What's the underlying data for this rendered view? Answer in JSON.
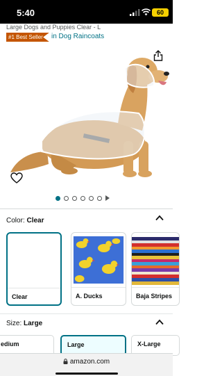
{
  "status": {
    "time": "5:40",
    "battery": "60"
  },
  "product": {
    "title": "Large Dogs and Puppies Clear - L",
    "badge": "#1 Best Seller",
    "category": "in Dog Raincoats"
  },
  "gallery": {
    "image_count": 6,
    "current_index": 1
  },
  "color": {
    "label": "Color:",
    "selected": "Clear",
    "options": [
      {
        "label": "Clear"
      },
      {
        "label": "A. Ducks"
      },
      {
        "label": "Baja Stripes"
      }
    ]
  },
  "size": {
    "label": "Size:",
    "selected": "Large",
    "options": [
      {
        "label": "edium"
      },
      {
        "label": "Large"
      },
      {
        "label": "X-Large"
      }
    ]
  },
  "browser": {
    "url": "amazon.com"
  },
  "colors": {
    "accent": "#007185",
    "badge": "#c45500",
    "battery": "#f5d000"
  }
}
